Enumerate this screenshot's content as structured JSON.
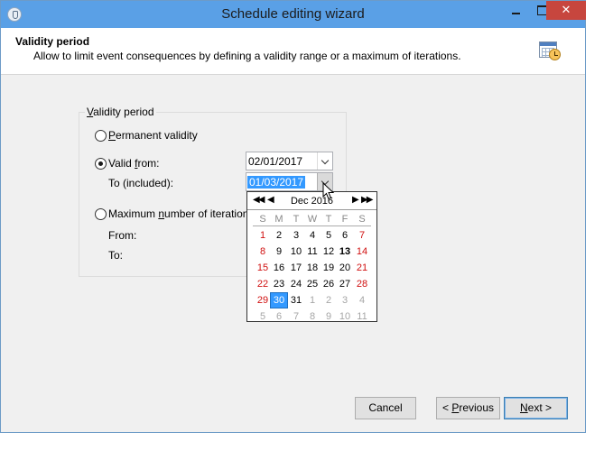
{
  "window": {
    "title": "Schedule editing wizard",
    "close_glyph": "✕"
  },
  "header": {
    "title": "Validity period",
    "description": "Allow to limit event consequences by defining a validity range or a maximum of iterations.",
    "icon": "calendar-clock-icon"
  },
  "group": {
    "legend_accel": "V",
    "legend_rest": "alidity period"
  },
  "options": {
    "permanent": {
      "accel": "P",
      "rest": "ermanent validity",
      "checked": false
    },
    "valid_from": {
      "pre": "Valid ",
      "accel": "f",
      "rest": "rom:",
      "checked": true
    },
    "max_iterations": {
      "pre": "Maximum ",
      "accel": "n",
      "rest": "umber of iteration",
      "checked": false
    }
  },
  "fields": {
    "to_included_label": "To (included):",
    "from_label": "From:",
    "to_label": "To:",
    "valid_from_value": "02/01/2017",
    "to_value": "01/03/2017"
  },
  "calendar": {
    "nav_prev_year": "◀◀",
    "nav_prev_month": "◀",
    "nav_next_month": "▶",
    "nav_next_year": "▶▶",
    "month_label": "Dec 2016",
    "weekdays": [
      "S",
      "M",
      "T",
      "W",
      "T",
      "F",
      "S"
    ],
    "weeks": [
      [
        "1",
        "2",
        "3",
        "4",
        "5",
        "6",
        "7"
      ],
      [
        "8",
        "9",
        "10",
        "11",
        "12",
        "13",
        "14"
      ],
      [
        "15",
        "16",
        "17",
        "18",
        "19",
        "20",
        "21"
      ],
      [
        "22",
        "23",
        "24",
        "25",
        "26",
        "27",
        "28"
      ],
      [
        "29",
        "30",
        "31",
        "1",
        "2",
        "3",
        "4"
      ],
      [
        "5",
        "6",
        "7",
        "8",
        "9",
        "10",
        "11"
      ]
    ],
    "selected": "30",
    "today": "13"
  },
  "buttons": {
    "cancel": {
      "pre": "",
      "accel": "",
      "rest": "Cancel"
    },
    "previous": {
      "pre": "< ",
      "accel": "P",
      "rest": "revious"
    },
    "next": {
      "pre": "",
      "accel": "N",
      "rest": "ext >"
    }
  },
  "colors": {
    "titlebar": "#5aa0e6",
    "close_button": "#c7463e",
    "selection": "#3399ff",
    "weekend": "#d01010"
  }
}
